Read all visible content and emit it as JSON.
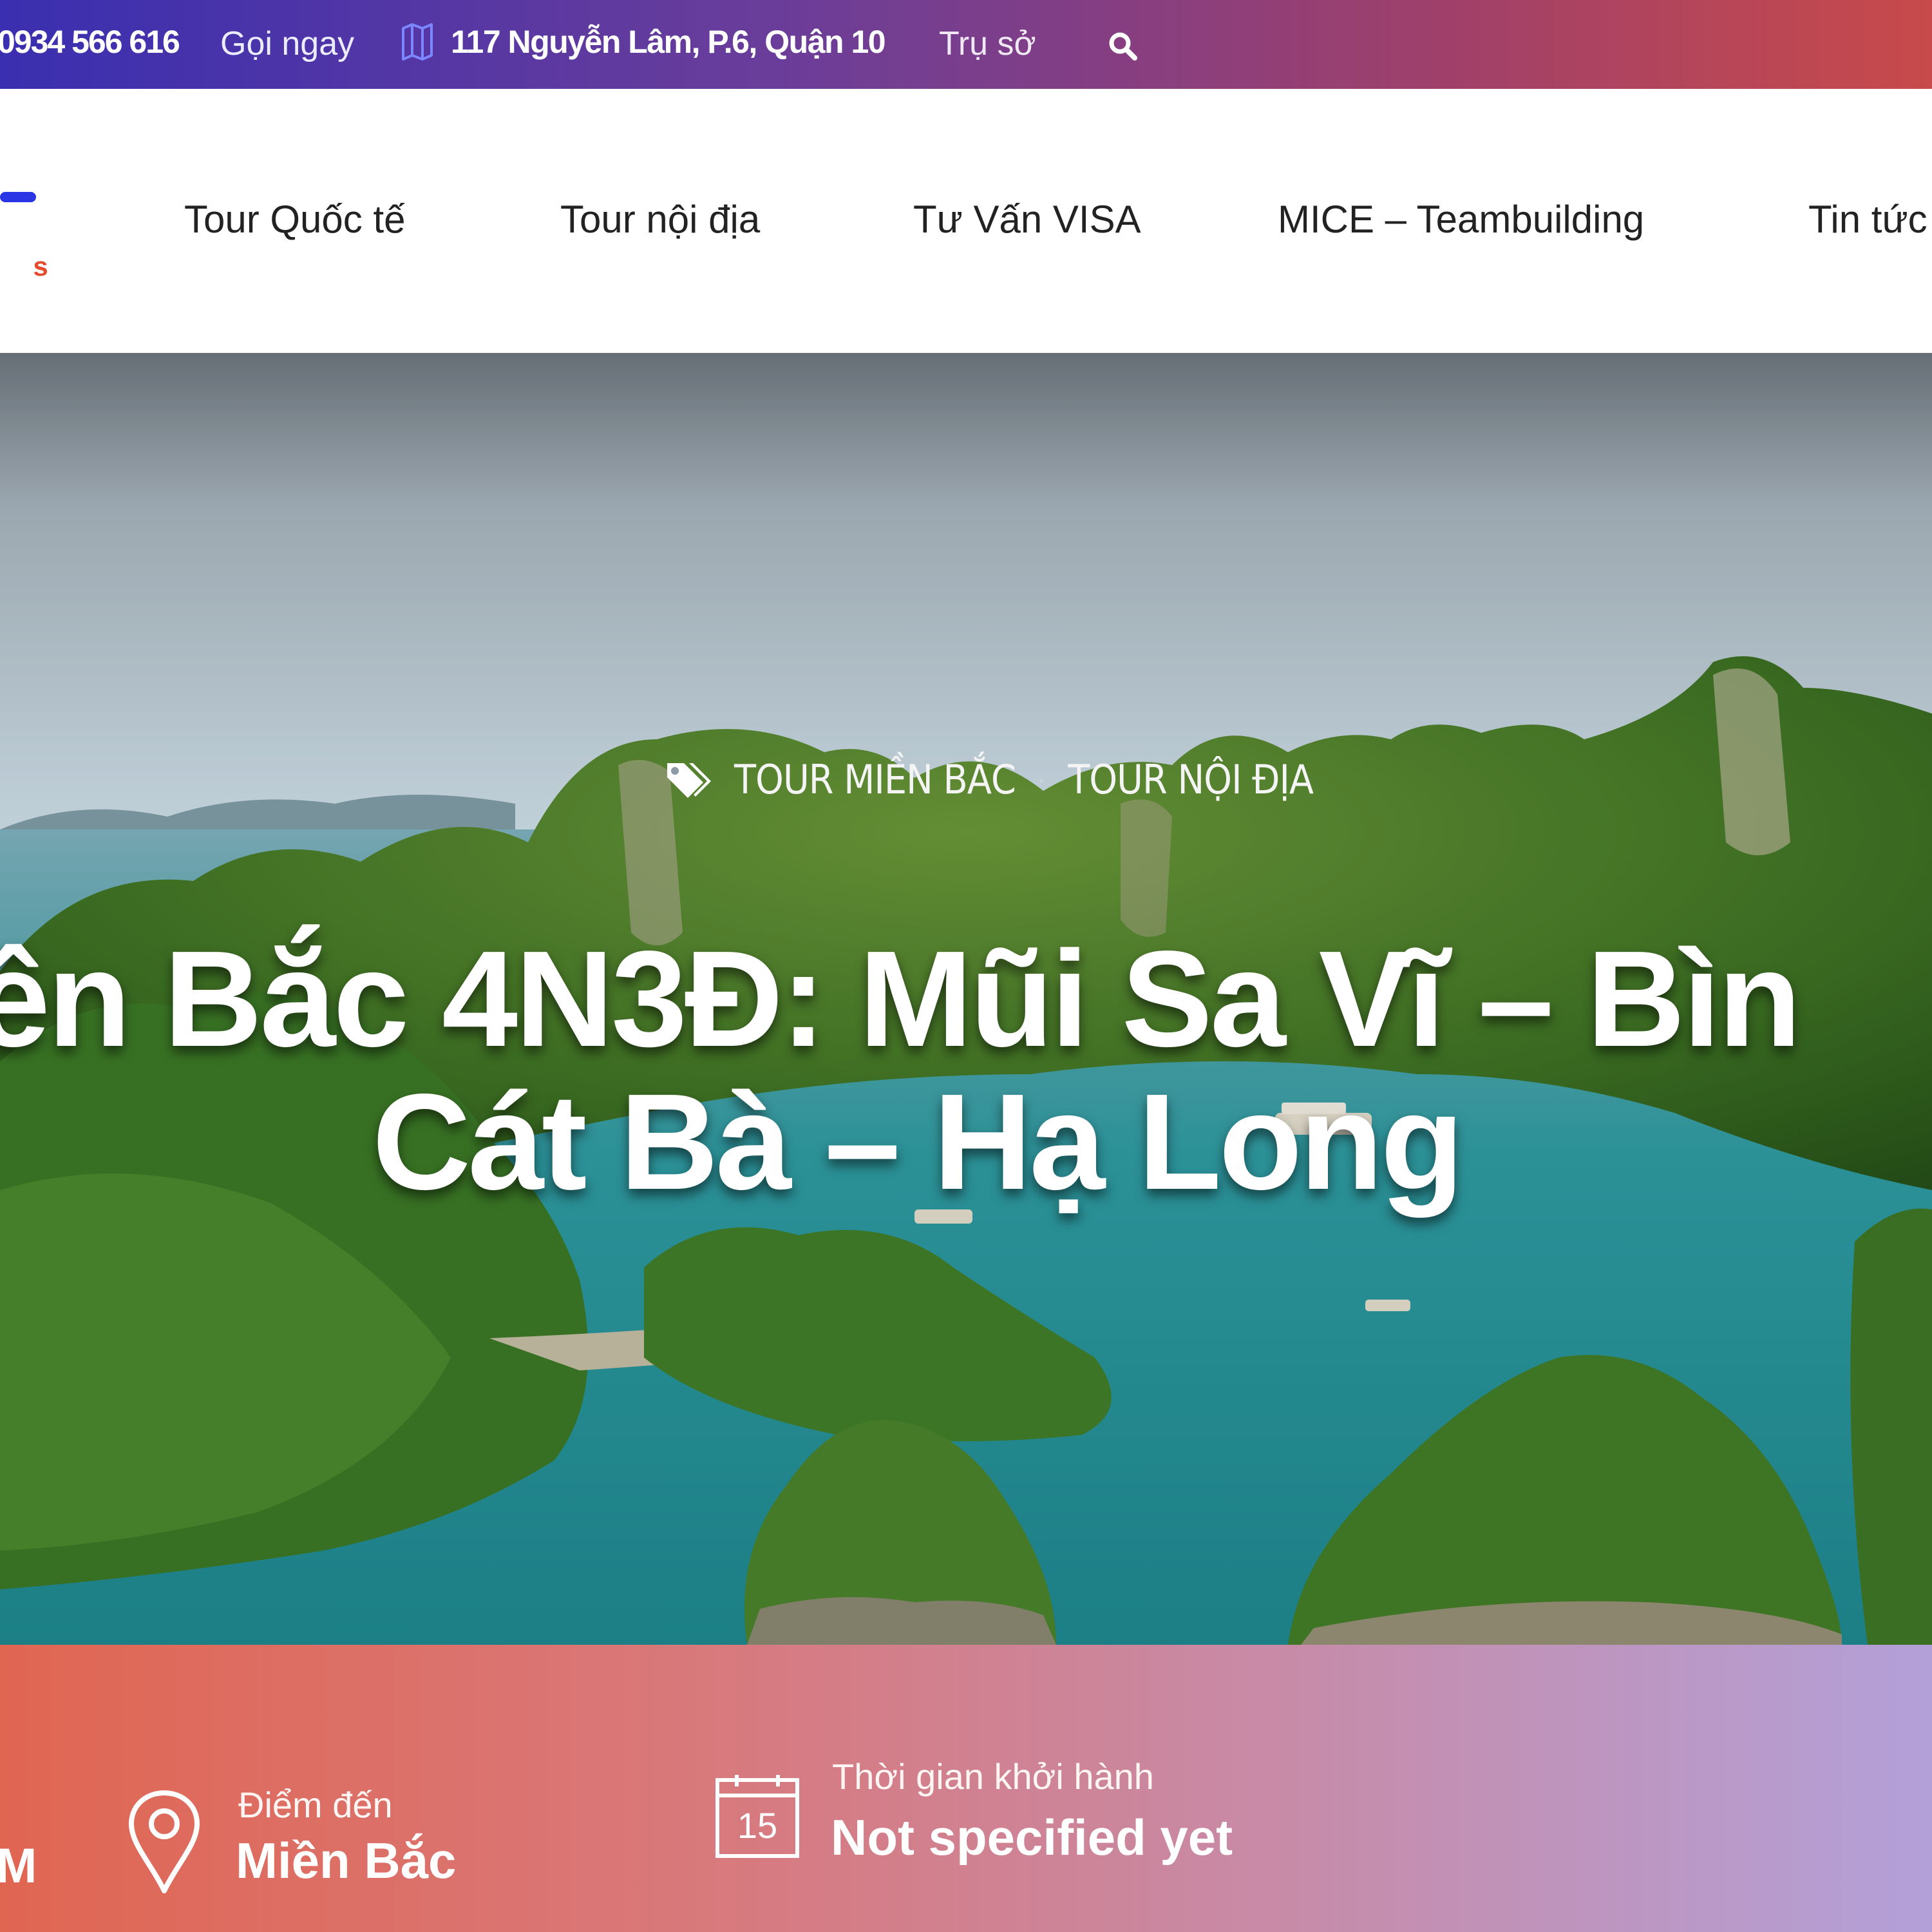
{
  "topbar": {
    "phone": "0934 566 616",
    "call_label": "Gọi ngay",
    "address": "117 Nguyễn Lâm, P.6, Quận 10",
    "address_label": "Trụ sở"
  },
  "logo": {
    "fragment": "o s"
  },
  "nav": {
    "items": [
      {
        "label": "Tour Quốc tế"
      },
      {
        "label": "Tour nội địa"
      },
      {
        "label": "Tư Vấn VISA"
      },
      {
        "label": "MICE – Teambuilding"
      },
      {
        "label": "Tin tức"
      }
    ]
  },
  "hero": {
    "tags": [
      "TOUR MIỀN BẮC",
      "TOUR NỘI ĐỊA"
    ],
    "separator": "·",
    "title_line1": "ền Bắc 4N3Đ: Mũi Sa Vĩ – Bìn",
    "title_line2": "Cát Bà – Hạ Long"
  },
  "info": {
    "partial_value": "M",
    "destination_label": "Điểm đến",
    "destination_value": "Miền Bắc",
    "departure_label": "Thời gian khởi hành",
    "departure_value": "Not specified yet",
    "calendar_day": "15"
  },
  "colors": {
    "accent_blue": "#2a36e6",
    "brand_red": "#e64a2e"
  }
}
